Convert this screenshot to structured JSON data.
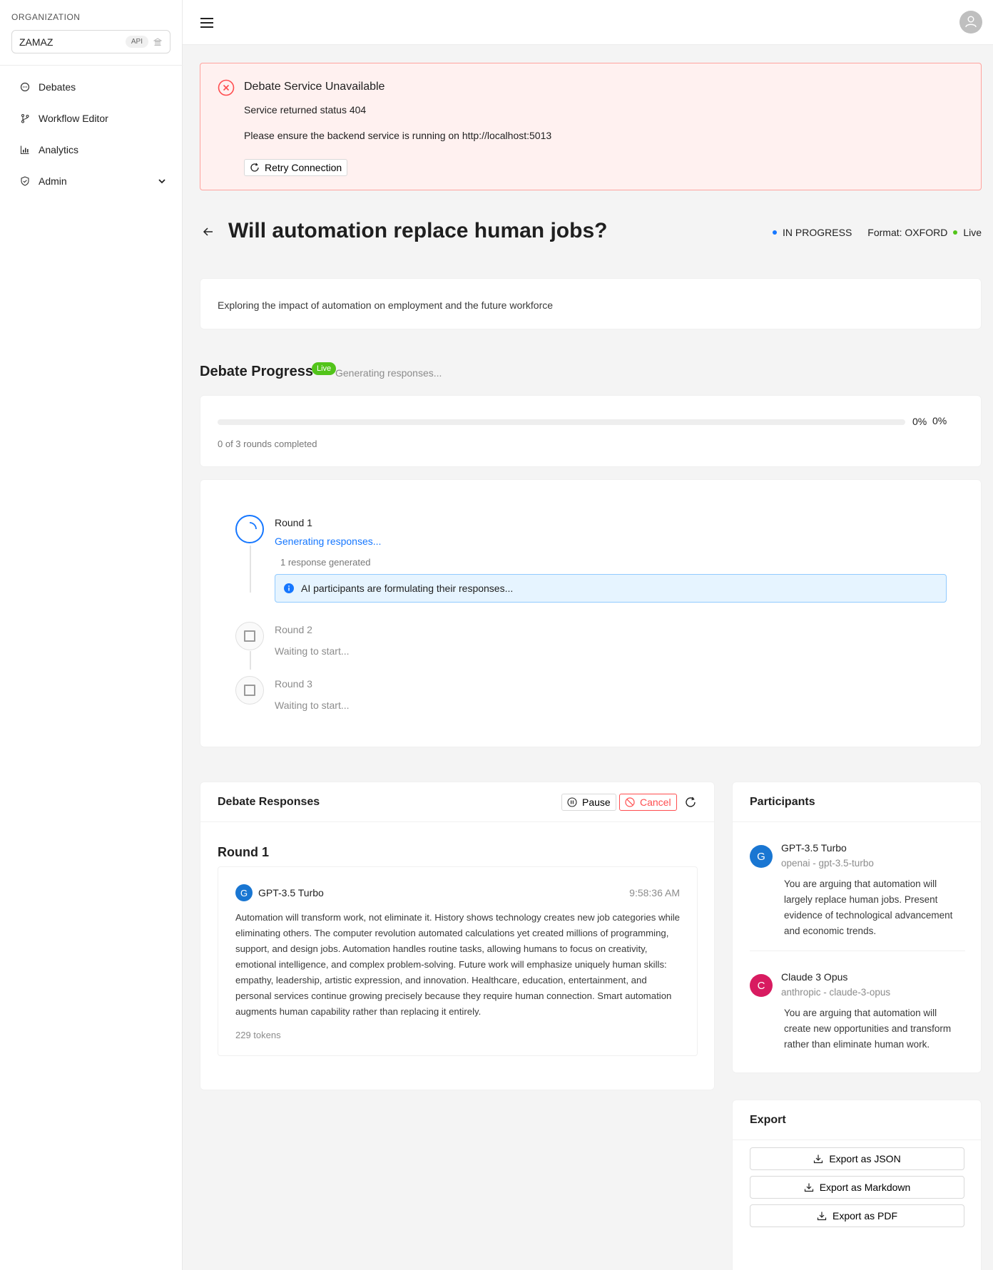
{
  "sidebar": {
    "org_label": "ORGANIZATION",
    "org_name": "ZAMAZ",
    "api_badge": "API",
    "items": [
      {
        "label": "Debates",
        "icon": "chat-bubble-icon"
      },
      {
        "label": "Workflow Editor",
        "icon": "branch-icon"
      },
      {
        "label": "Analytics",
        "icon": "bar-chart-icon"
      },
      {
        "label": "Admin",
        "icon": "shield-icon"
      }
    ]
  },
  "header": {
    "menu_icon": "hamburger-menu-icon",
    "avatar_icon": "user-icon"
  },
  "alert": {
    "title": "Debate Service Unavailable",
    "line1": "Service returned status 404",
    "line2": "Please ensure the backend service is running on http://localhost:5013",
    "retry_label": "Retry Connection"
  },
  "debate": {
    "title": "Will automation replace human jobs?",
    "status": "IN PROGRESS",
    "format": "Format: OXFORD",
    "live": "Live",
    "description": "Exploring the impact of automation on employment and the future workforce"
  },
  "progress": {
    "heading": "Debate Progress",
    "live_tag": "Live",
    "subtitle": "Generating responses...",
    "percent": 0,
    "percent_label_1": "0%",
    "percent_label_2": "0%",
    "rounds_completed": "0 of 3 rounds completed"
  },
  "rounds": [
    {
      "title": "Round 1",
      "status": "Generating responses...",
      "count": "1 response generated",
      "info": "AI participants are formulating their responses..."
    },
    {
      "title": "Round 2",
      "status": "Waiting to start..."
    },
    {
      "title": "Round 3",
      "status": "Waiting to start..."
    }
  ],
  "responses": {
    "title": "Debate Responses",
    "pause_label": "Pause",
    "cancel_label": "Cancel",
    "round_title": "Round 1",
    "items": [
      {
        "avatar": "G",
        "model": "GPT-3.5 Turbo",
        "time": "9:58:36 AM",
        "text": "Automation will transform work, not eliminate it. History shows technology creates new job categories while eliminating others. The computer revolution automated calculations yet created millions of programming, support, and design jobs. Automation handles routine tasks, allowing humans to focus on creativity, emotional intelligence, and complex problem-solving. Future work will emphasize uniquely human skills: empathy, leadership, artistic expression, and innovation. Healthcare, education, entertainment, and personal services continue growing precisely because they require human connection. Smart automation augments human capability rather than replacing it entirely.",
        "tokens": "229 tokens"
      }
    ]
  },
  "participants": {
    "title": "Participants",
    "items": [
      {
        "avatar": "G",
        "color": "#1976d2",
        "name": "GPT-3.5 Turbo",
        "model": "openai - gpt-3.5-turbo",
        "desc": "You are arguing that automation will largely replace human jobs. Present evidence of technological advancement and economic trends."
      },
      {
        "avatar": "C",
        "color": "#d81b60",
        "name": "Claude 3 Opus",
        "model": "anthropic - claude-3-opus",
        "desc": "You are arguing that automation will create new opportunities and transform rather than eliminate human work."
      }
    ]
  },
  "export": {
    "title": "Export",
    "json_label": "Export as JSON",
    "md_label": "Export as Markdown",
    "pdf_label": "Export as PDF"
  },
  "colors": {
    "accent": "#1677ff",
    "live": "#52c41a",
    "danger": "#ff4d4f"
  }
}
